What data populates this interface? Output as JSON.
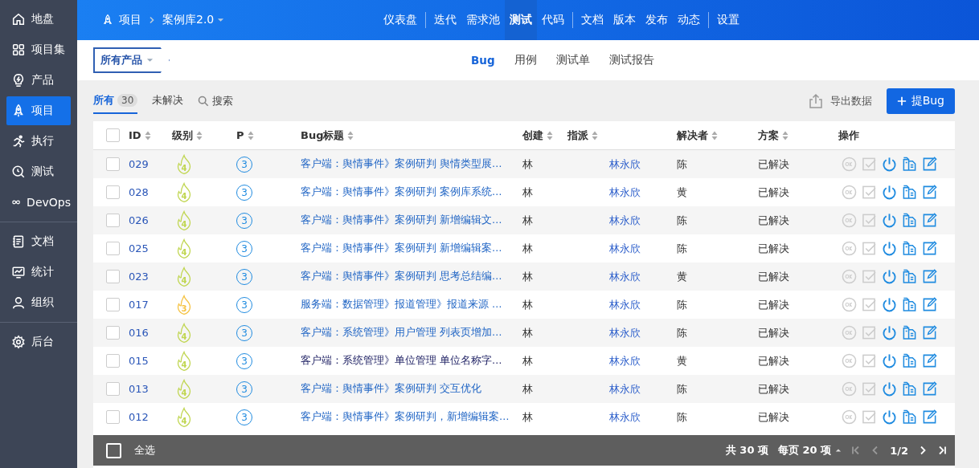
{
  "sidebar": {
    "groups": [
      [
        {
          "label": "地盘",
          "selected": false
        },
        {
          "label": "项目集",
          "selected": false
        },
        {
          "label": "产品",
          "selected": false
        },
        {
          "label": "项目",
          "selected": true
        },
        {
          "label": "执行",
          "selected": false
        },
        {
          "label": "测试",
          "selected": false
        },
        {
          "label": "DevOps",
          "selected": false
        }
      ],
      [
        {
          "label": "文档",
          "selected": false
        },
        {
          "label": "统计",
          "selected": false
        },
        {
          "label": "组织",
          "selected": false
        }
      ],
      [
        {
          "label": "后台",
          "selected": false
        }
      ]
    ]
  },
  "breadcrumb": {
    "section": "项目",
    "project": "案例库2.0"
  },
  "top_nav": [
    [
      {
        "label": "仪表盘",
        "selected": false
      }
    ],
    [
      {
        "label": "迭代",
        "selected": false
      },
      {
        "label": "需求池",
        "selected": false
      },
      {
        "label": "测试",
        "selected": true
      },
      {
        "label": "代码",
        "selected": false
      }
    ],
    [
      {
        "label": "文档",
        "selected": false
      },
      {
        "label": "版本",
        "selected": false
      },
      {
        "label": "发布",
        "selected": false
      },
      {
        "label": "动态",
        "selected": false
      }
    ],
    [
      {
        "label": "设置",
        "selected": false
      }
    ]
  ],
  "product_picker": "所有产品",
  "sub_tabs": [
    {
      "label": "Bug",
      "selected": true
    },
    {
      "label": "用例",
      "selected": false
    },
    {
      "label": "测试单",
      "selected": false
    },
    {
      "label": "测试报告",
      "selected": false
    }
  ],
  "filters": [
    {
      "label": "所有",
      "count": "30",
      "selected": true
    },
    {
      "label": "未解决",
      "selected": false
    }
  ],
  "search_label": "搜索",
  "export_label": "导出数据",
  "create_label": "提Bug",
  "all_checked": false,
  "columns": [
    "ID",
    "级别",
    "P",
    "Bug标题",
    "创建",
    "指派",
    "解决者",
    "方案",
    "操作"
  ],
  "row_actions": [
    {
      "kind": "confirm",
      "disabled": true
    },
    {
      "kind": "close",
      "disabled": true
    },
    {
      "kind": "activate",
      "disabled": false
    },
    {
      "kind": "copy",
      "disabled": false
    },
    {
      "kind": "edit",
      "disabled": false
    }
  ],
  "rows": [
    {
      "checked": false,
      "id": "029",
      "severity": "4",
      "priority": "3",
      "title": "客户端：舆情事件》案例研判 舆情类型展…",
      "visited": false,
      "creator": "林",
      "assignee": "林永欣",
      "resolver": "陈",
      "resolution": "已解决"
    },
    {
      "checked": false,
      "id": "028",
      "severity": "4",
      "priority": "3",
      "title": "客户端：舆情事件》案例研判 案例库系统…",
      "visited": false,
      "creator": "林",
      "assignee": "林永欣",
      "resolver": "黄",
      "resolution": "已解决"
    },
    {
      "checked": false,
      "id": "026",
      "severity": "4",
      "priority": "3",
      "title": "客户端：舆情事件》案例研判 新增编辑文…",
      "visited": false,
      "creator": "林",
      "assignee": "林永欣",
      "resolver": "陈",
      "resolution": "已解决"
    },
    {
      "checked": false,
      "id": "025",
      "severity": "4",
      "priority": "3",
      "title": "客户端：舆情事件》案例研判 新增编辑案…",
      "visited": false,
      "creator": "林",
      "assignee": "林永欣",
      "resolver": "陈",
      "resolution": "已解决"
    },
    {
      "checked": false,
      "id": "023",
      "severity": "4",
      "priority": "3",
      "title": "客户端：舆情事件》案例研判 思考总结编…",
      "visited": false,
      "creator": "林",
      "assignee": "林永欣",
      "resolver": "黄",
      "resolution": "已解决"
    },
    {
      "checked": false,
      "id": "017",
      "severity": "3",
      "priority": "3",
      "title": "服务端：数据管理》报道管理》报道来源 …",
      "visited": false,
      "creator": "林",
      "assignee": "林永欣",
      "resolver": "陈",
      "resolution": "已解决"
    },
    {
      "checked": false,
      "id": "016",
      "severity": "4",
      "priority": "3",
      "title": "客户端：系统管理》用户管理 列表页增加…",
      "visited": false,
      "creator": "林",
      "assignee": "林永欣",
      "resolver": "陈",
      "resolution": "已解决"
    },
    {
      "checked": false,
      "id": "015",
      "severity": "4",
      "priority": "3",
      "title": "客户端：系统管理》单位管理 单位名称字…",
      "visited": true,
      "creator": "林",
      "assignee": "林永欣",
      "resolver": "黄",
      "resolution": "已解决"
    },
    {
      "checked": false,
      "id": "013",
      "severity": "4",
      "priority": "3",
      "title": "客户端：舆情事件》案例研判 交互优化",
      "visited": false,
      "creator": "林",
      "assignee": "林永欣",
      "resolver": "陈",
      "resolution": "已解决"
    },
    {
      "checked": false,
      "id": "012",
      "severity": "4",
      "priority": "3",
      "title": "客户端：舆情事件》案例研判，新增编辑案…",
      "visited": false,
      "creator": "林",
      "assignee": "林永欣",
      "resolver": "陈",
      "resolution": "已解决"
    }
  ],
  "footer": {
    "checked": false,
    "select_all": "全选",
    "total": "共 30 项",
    "per_page": "每页 20 项",
    "page": "1/2"
  }
}
